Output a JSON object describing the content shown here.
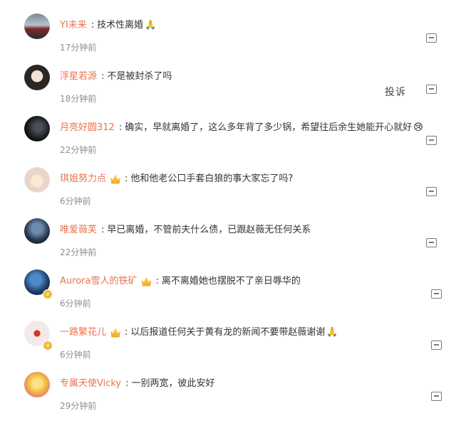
{
  "comments": [
    {
      "user": "YI未来",
      "sep": ":",
      "text": "技术性离婚",
      "emoji": "🙏",
      "time": "17分钟前",
      "crown": false
    },
    {
      "user": "浮星若源",
      "sep": ":",
      "text": "不是被封杀了吗",
      "emoji": "",
      "time": "18分钟前",
      "crown": false
    },
    {
      "user": "月亮好圆312",
      "sep": ":",
      "text": "确实，早就离婚了，这么多年背了多少锅，希望往后余生她能开心就好",
      "emoji": "😢",
      "time": "22分钟前",
      "crown": false
    },
    {
      "user": "琪姐努力点",
      "sep": ":",
      "text": "他和他老公口手套白狼的事大家忘了吗?",
      "emoji": "",
      "time": "6分钟前",
      "crown": true
    },
    {
      "user": "唯爱薇芙",
      "sep": ":",
      "text": "早已离婚，不管前夫什么债，已跟赵薇无任何关系",
      "emoji": "",
      "time": "22分钟前",
      "crown": false
    },
    {
      "user": "Aurora雪人的铁矿",
      "sep": ":",
      "text": "离不离婚她也摆脱不了亲日辱华的",
      "emoji": "",
      "time": "6分钟前",
      "crown": true
    },
    {
      "user": "一路繁花儿",
      "sep": ":",
      "text": "以后报道任何关于黄有龙的新闻不要带赵薇谢谢",
      "emoji": "🙏",
      "time": "6分钟前",
      "crown": true
    },
    {
      "user": "专属天使Vicky",
      "sep": ":",
      "text": "一别两宽，彼此安好",
      "emoji": "",
      "time": "29分钟前",
      "crown": false
    }
  ],
  "report_label": "投诉",
  "icons": {
    "reply": "comment-icon",
    "crown": "crown-icon",
    "verified": "verified-badge-icon"
  },
  "colors": {
    "username": "#eb7350",
    "text": "#333333",
    "time": "#8f8f8f"
  }
}
